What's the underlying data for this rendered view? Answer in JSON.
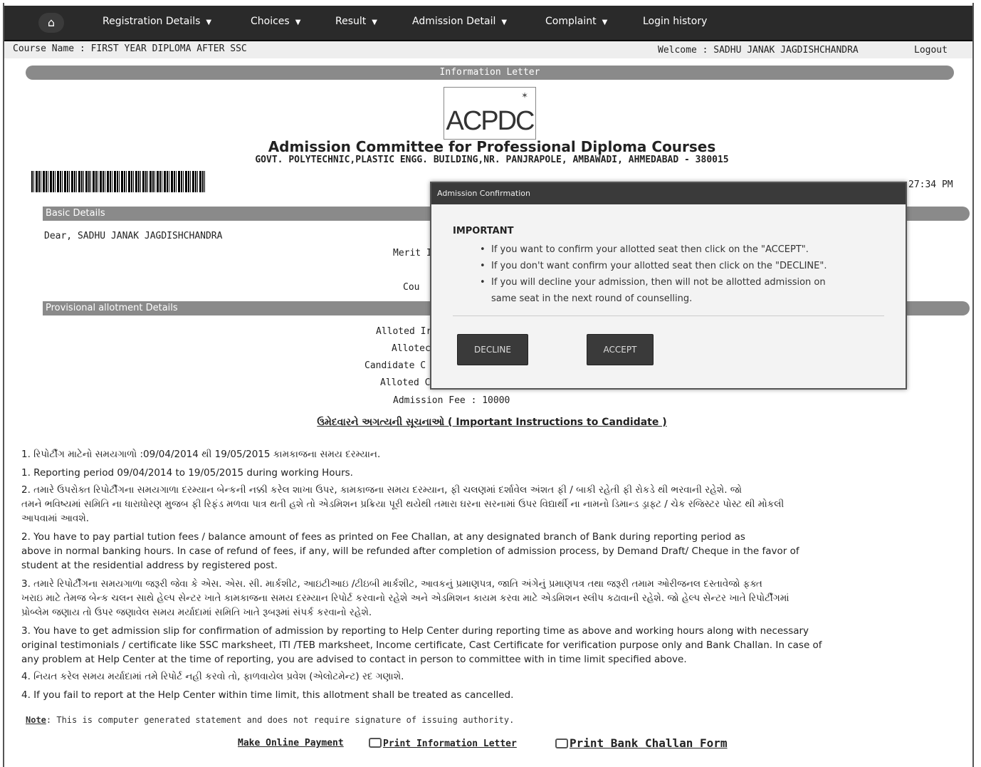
{
  "nav": {
    "home_icon": "home-icon",
    "items": [
      {
        "label": "Registration Details",
        "dropdown": true
      },
      {
        "label": "Choices",
        "dropdown": true
      },
      {
        "label": "Result",
        "dropdown": true
      },
      {
        "label": "Admission Detail",
        "dropdown": true
      },
      {
        "label": "Complaint",
        "dropdown": true
      },
      {
        "label": "Login history",
        "dropdown": false
      }
    ]
  },
  "subheader": {
    "course": "Course Name : FIRST YEAR DIPLOMA AFTER SSC",
    "welcome": "Welcome : SADHU JANAK JAGDISHCHANDRA",
    "logout": "Logout"
  },
  "letter": {
    "title_bar": "Information Letter",
    "logo_text": "ACPDC",
    "org_name": "Admission Committee for Professional Diploma Courses",
    "org_address": "GOVT. POLYTECHNIC,PLASTIC ENGG. BUILDING,NR. PANJRAPOLE, AMBAWADI, AHMEDABAD - 380015",
    "time_fragment": "27:34 PM"
  },
  "basic": {
    "heading": "Basic Details",
    "dear": "Dear, SADHU JANAK JAGDISHCHANDRA",
    "merit_partial": "Merit I",
    "course_partial": "Cou"
  },
  "allotment": {
    "heading": "Provisional allotment Details",
    "alloted_inst_partial": "Alloted Ir",
    "alloted_partial": "Allotec",
    "candidate_partial": "Candidate C",
    "alloted_c_partial": "Alloted C",
    "fee": "Admission Fee : 10000"
  },
  "instructions": {
    "heading": "ઉમેદવારને અગત્યની સૂચનાઓ ( Important Instructions to Candidate )",
    "lines": [
      "1. રિપોર્ટીંગ માટેનો સમયગાળો :09/04/2014  થી 19/05/2015  કામકાજના સમય દરમ્યાન.",
      "1. Reporting period 09/04/2014 to 19/05/2015  during working Hours.",
      "2. તમારે ઉપરોક્ત રિપોર્ટીંગના સમયગાળા દરમ્યાન બેન્કની નક્કી કરેલ શાખા ઉપર, કામકાજના સમય દરમ્યાન, ફી ચલણમાં દર્શાવેલ અંશત ફી / બાકી રહેતી ફી રોકડે થી ભરવાની રહેશે. જો",
      "    તમને ભવિષ્યમાં સમિતિ ના ધારાધોરણ મુજબ ફી રિફંડ મળવા પાત્ર થતી હશે તો એડમિશન પ્રક્રિયા પૂરી થયેથી તમારા ઘરના સરનામાં ઉપર વિદ્યાર્થી ના નામનો ડિમાન્ડ ડ્રાફ્ટ / ચેક રજિસ્ટર પોસ્ટ થી મોકલી",
      "    આપવામાં આવશે.",
      "2. You have to pay partial tution fees / balance amount of fees as printed on Fee Challan, at any designated branch of Bank during reporting period as",
      "    above in normal banking hours. In case of refund of fees, if any, will be refunded after completion of admission process, by Demand Draft/ Cheque in the favor of",
      "    student at the residential address by registered post.",
      "3. તમારે રિપોર્ટીંગના સમયગાળા જરૂરી જેવા કે એસ. એસ. સી. માર્કશીટ, આઇટીઆઇ /ટીઇબી માર્કશીટ, આવકનું પ્રમાણપત્ર, જાતિ અંગેનું પ્રમાણપત્ર તથા જરૂરી તમામ ઓરીજનલ દસ્તાવેજો ફક્ત",
      "    ખરાઇ માટે તેમજ બેન્ક ચલન સાથે હેલ્પ સેન્ટર ખાતે કામકાજના સમય દરમ્યાન રિપોર્ટ કરવાનો રહેશે અને એડમિશન કાયમ કરવા માટે એડમિશન સ્લીપ કઢાવાની રહેશે. જો હેલ્પ સેન્ટર ખાતે રિપોર્ટીંગમાં",
      "    પ્રોબ્લેમ જણાય તો ઉપર જણાવેલ સમય મર્યાદામાં સમિતિ ખાતે રૂબરૂમાં સંપર્ક કરવાનો રહેશે.",
      "3. You have to get admission slip for confirmation of admission by reporting to Help Center during reporting time as above and working hours along with necessary",
      "    original testimonials / certificate like SSC marksheet, ITI /TEB marksheet, Income certificate, Cast Certificate for verification purpose only and Bank Challan. In case of",
      "    any problem at Help Center at the time of reporting, you are advised to contact in person to committee with in time limit specified above.",
      "4. નિયત કરેલ સમય મર્યાદામાં તમે રિપોર્ટ નહી કરવો તો, ફાળવાયેલ પ્રવેશ (એલોટમેન્ટ) રદ ગણાશે.",
      "4. If you fail to report at the Help Center within time limit, this allotment shall be treated as cancelled."
    ],
    "note_label": "Note",
    "note_text": ": This is computer generated statement and does not require signature of issuing authority."
  },
  "links": {
    "payment": "Make Online Payment",
    "print_letter": "Print Information Letter",
    "print_challan": "Print Bank Challan Form"
  },
  "modal": {
    "title": "Admission Confirmation",
    "important": "IMPORTANT",
    "points": [
      "If you want to confirm your allotted seat then click on the \"ACCEPT\".",
      "If you don't want confirm your allotted seat then click on the \"DECLINE\".",
      "If you will decline your admission, then will not be allotted admission on",
      "same seat in the next round of counselling."
    ],
    "decline": "DECLINE",
    "accept": "ACCEPT"
  }
}
